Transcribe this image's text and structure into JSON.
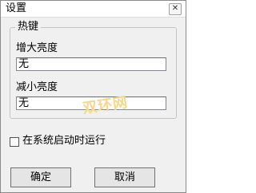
{
  "window": {
    "title": "设置",
    "close_glyph": "✕"
  },
  "hotkey_group": {
    "legend": "热键",
    "increase": {
      "label": "增大亮度",
      "value": "无"
    },
    "decrease": {
      "label": "减小亮度",
      "value": "无"
    }
  },
  "options": {
    "startup_label": "在系统启动时运行",
    "startup_checked": false
  },
  "buttons": {
    "ok": "确定",
    "cancel": "取消"
  },
  "watermark": {
    "text": "双环网"
  }
}
